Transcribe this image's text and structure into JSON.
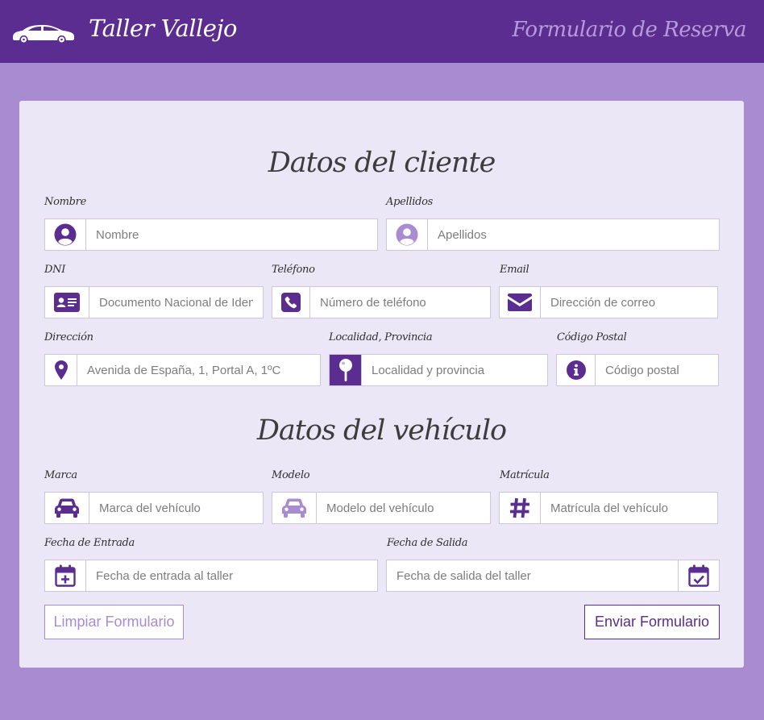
{
  "header": {
    "title": "Taller Vallejo",
    "subtitle": "Formulario de Reserva"
  },
  "client": {
    "title": "Datos del cliente",
    "nombre": {
      "label": "Nombre",
      "placeholder": "Nombre",
      "icon": "user-circle-icon"
    },
    "apellidos": {
      "label": "Apellidos",
      "placeholder": "Apellidos",
      "icon": "user-circle-icon"
    },
    "dni": {
      "label": "DNI",
      "placeholder": "Documento Nacional de Identidad",
      "icon": "id-card-icon"
    },
    "telefono": {
      "label": "Teléfono",
      "placeholder": "Número de teléfono",
      "icon": "phone-icon"
    },
    "email": {
      "label": "Email",
      "placeholder": "Dirección de correo",
      "icon": "envelope-icon"
    },
    "direccion": {
      "label": "Dirección",
      "placeholder": "Avenida de España, 1, Portal A, 1ºC",
      "icon": "map-marker-icon"
    },
    "localidad": {
      "label": "Localidad, Provincia",
      "placeholder": "Localidad y provincia",
      "icon": "map-pin-icon"
    },
    "codigo_postal": {
      "label": "Código Postal",
      "placeholder": "Código postal",
      "icon": "info-circle-icon"
    }
  },
  "vehicle": {
    "title": "Datos del vehículo",
    "marca": {
      "label": "Marca",
      "placeholder": "Marca del vehículo",
      "icon": "car-icon"
    },
    "modelo": {
      "label": "Modelo",
      "placeholder": "Modelo del vehículo",
      "icon": "car-icon"
    },
    "matricula": {
      "label": "Matrícula",
      "placeholder": "Matrícula del vehículo",
      "icon": "hashtag-icon"
    },
    "entrada": {
      "label": "Fecha de Entrada",
      "placeholder": "Fecha de entrada al taller",
      "icon": "calendar-plus-icon"
    },
    "salida": {
      "label": "Fecha de Salida",
      "placeholder": "Fecha de salida del taller",
      "icon": "calendar-check-icon"
    }
  },
  "buttons": {
    "clear": "Limpiar Formulario",
    "submit": "Enviar Formulario"
  },
  "colors": {
    "primary": "#5b2d91",
    "light": "#a98bd2",
    "card": "#ece7f6"
  }
}
